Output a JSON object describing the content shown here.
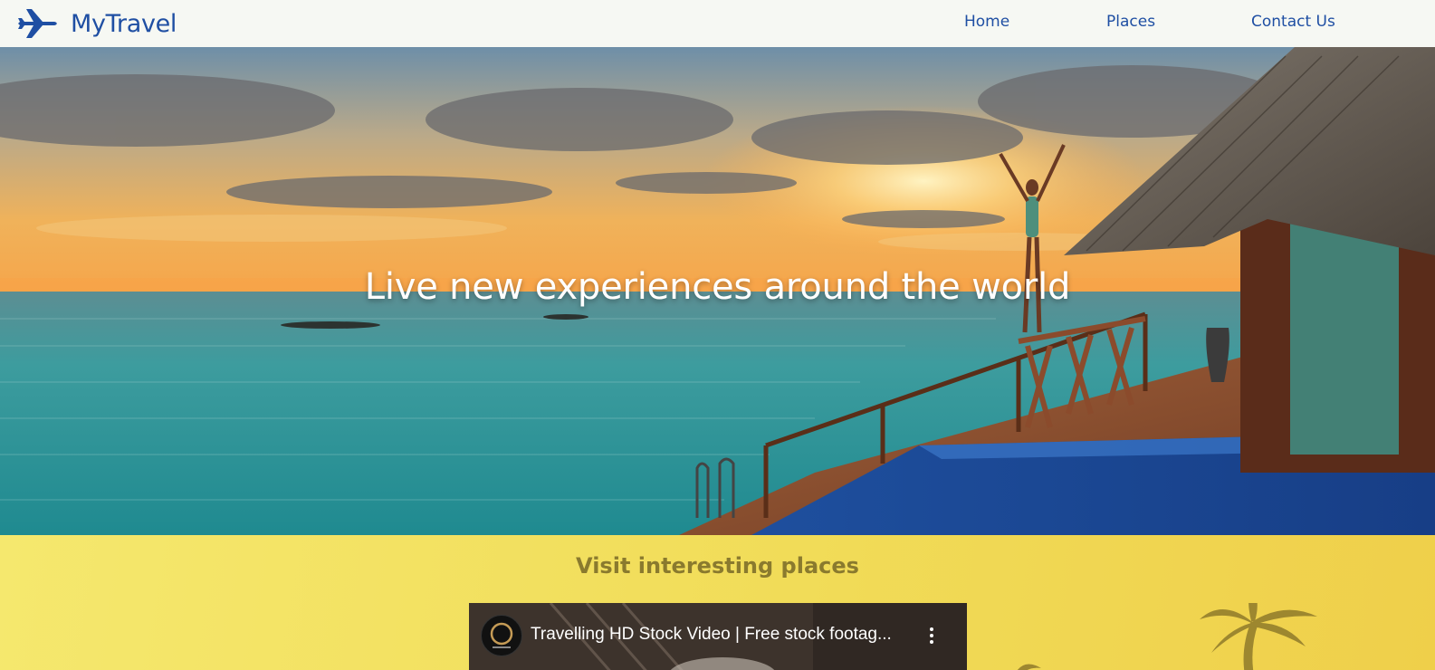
{
  "brand": {
    "name": "MyTravel",
    "icon": "airplane-icon",
    "color": "#1f4fa3"
  },
  "nav": {
    "items": [
      {
        "label": "Home"
      },
      {
        "label": "Places"
      },
      {
        "label": "Contact Us"
      }
    ]
  },
  "hero": {
    "title": "Live new experiences around the world"
  },
  "places": {
    "title": "Visit interesting places",
    "video": {
      "title": "Travelling HD Stock Video | Free stock footag...",
      "menu_icon": "more-vertical-icon",
      "avatar_icon": "channel-avatar-icon"
    }
  },
  "colors": {
    "nav_background": "#f6f8f3",
    "section_background": "#f1dc58",
    "section_title": "#8a7a2e"
  }
}
